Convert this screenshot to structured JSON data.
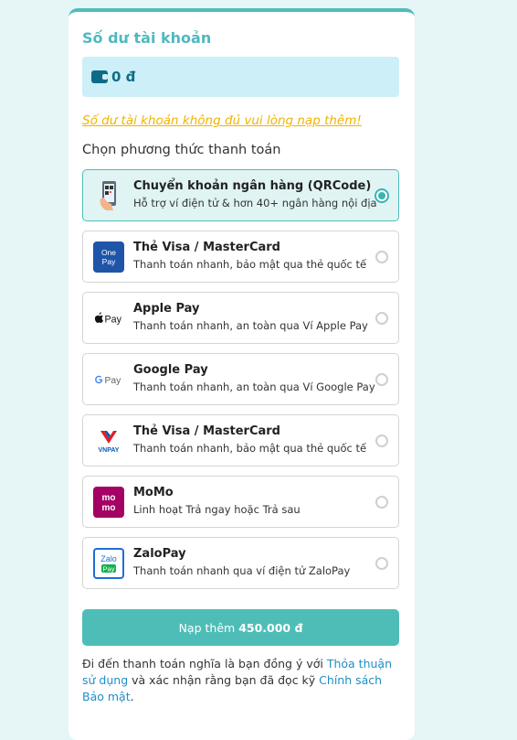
{
  "section_title": "Số dư tài khoản",
  "balance": {
    "amount": "0 đ"
  },
  "warning": "Số dư tài khoản không đủ vui lòng nạp thêm!",
  "choose_label": "Chọn phương thức thanh toán",
  "options": [
    {
      "name": "Chuyển khoản ngân hàng (QRCode)",
      "desc": "Hỗ trợ ví điện tử & hơn 40+ ngân hàng nội địa",
      "icon": "qr-phone-icon",
      "selected": true
    },
    {
      "name": "Thẻ Visa / MasterCard",
      "desc": "Thanh toán nhanh, bảo mật qua thẻ quốc tế",
      "icon": "onepay-icon",
      "logo_text": "One Pay",
      "selected": false
    },
    {
      "name": "Apple Pay",
      "desc": "Thanh toán nhanh, an toàn qua Ví Apple Pay",
      "icon": "apple-pay-icon",
      "logo_text": "Pay",
      "selected": false
    },
    {
      "name": "Google Pay",
      "desc": "Thanh toán nhanh, an toàn qua Ví Google Pay",
      "icon": "google-pay-icon",
      "logo_text": "Pay",
      "selected": false
    },
    {
      "name": "Thẻ Visa / MasterCard",
      "desc": "Thanh toán nhanh, bảo mật qua thẻ quốc tế",
      "icon": "vnpay-icon",
      "logo_text": "VNPAY",
      "selected": false
    },
    {
      "name": "MoMo",
      "desc": "Linh hoạt Trả ngay hoặc Trả sau",
      "icon": "momo-icon",
      "logo_text": "mo mo",
      "selected": false
    },
    {
      "name": "ZaloPay",
      "desc": "Thanh toán nhanh qua ví điện tử ZaloPay",
      "icon": "zalopay-icon",
      "logo_text": "Zalo Pay",
      "selected": false
    }
  ],
  "topup_button": {
    "prefix": "Nạp thêm",
    "amount": "450.000 đ"
  },
  "terms": {
    "text1": "Đi đến thanh toán nghĩa là bạn đồng ý với ",
    "link1": "Thỏa thuận sử dụng",
    "text2": " và xác nhận rằng bạn đã đọc kỹ ",
    "link2": "Chính sách Bảo mật",
    "text3": "."
  },
  "colors": {
    "accent": "#4fbdb7",
    "title": "#50b8c0",
    "warning": "#f0b400",
    "link": "#1f8ec6",
    "balance_bg": "#cdeff7"
  }
}
